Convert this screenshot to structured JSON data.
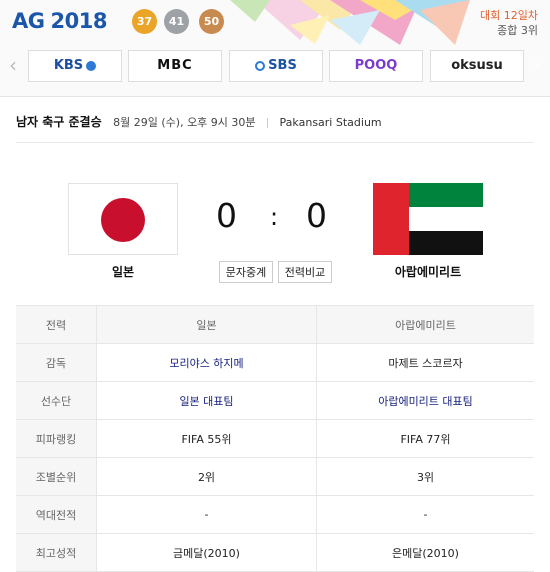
{
  "banner": {
    "logo_ag": "AG",
    "logo_year": "2018",
    "medals": {
      "gold": "37",
      "silver": "41",
      "bronze": "50"
    },
    "day": "대회 12일차",
    "rank": "종합 3위",
    "broadcasters": [
      "KBS",
      "MBC",
      "SBS",
      "POOQ",
      "oksusu"
    ],
    "prev_arrow": "‹",
    "next_arrow": "›"
  },
  "match": {
    "title": "남자 축구 준결승",
    "date": "8월 29일 (수), 오후 9시 30분",
    "stadium": "Pakansari Stadium",
    "home": {
      "name": "일본",
      "score": "0"
    },
    "away": {
      "name": "아랍에미리트",
      "score": "0"
    },
    "colon": ":",
    "buttons": {
      "text_relay": "문자중계",
      "compare": "전력비교"
    }
  },
  "table": {
    "headers": [
      "전력",
      "일본",
      "아랍에미리트"
    ],
    "rows": [
      {
        "label": "감독",
        "home": "모리야스 하지메",
        "away": "마제트 스코르자"
      },
      {
        "label": "선수단",
        "home": "일본 대표팀",
        "away": "아랍에미리트 대표팀"
      },
      {
        "label": "피파랭킹",
        "home": "FIFA 55위",
        "away": "FIFA 77위"
      },
      {
        "label": "조별순위",
        "home": "2위",
        "away": "3위"
      },
      {
        "label": "역대전적",
        "home": "-",
        "away": "-"
      },
      {
        "label": "최고성적",
        "home": "금메달(2010)",
        "away": "은메달(2010)"
      }
    ]
  },
  "colors": {
    "accent": "#1b56a8",
    "day": "#e0602d",
    "gold": "#eaa528",
    "silver": "#9ea2a6",
    "bronze": "#c98a4f"
  }
}
